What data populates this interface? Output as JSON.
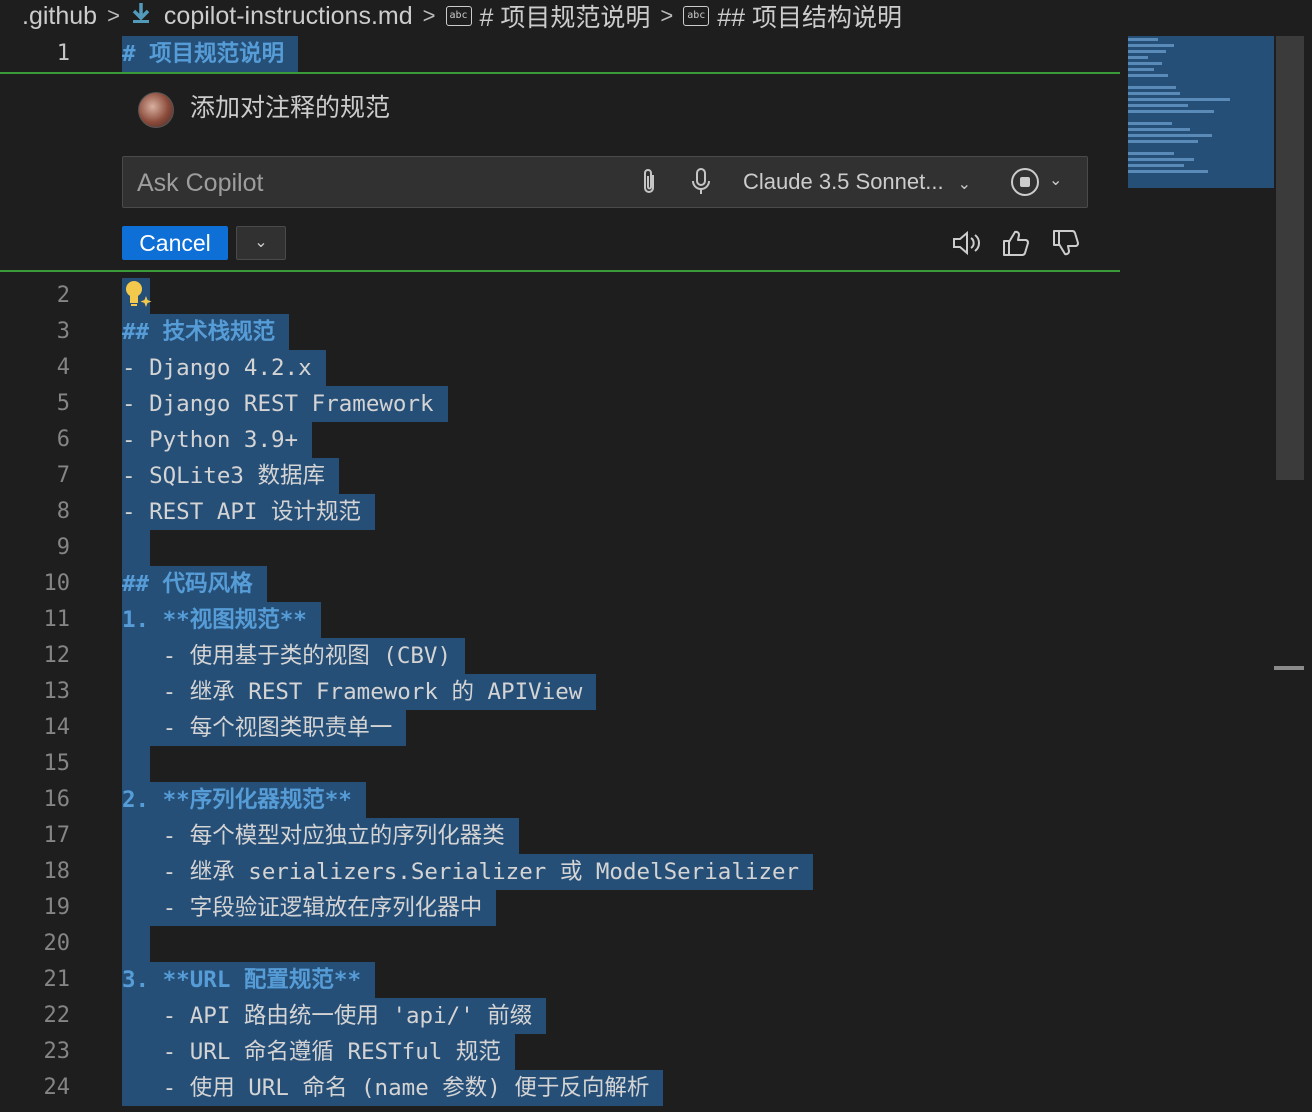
{
  "breadcrumb": {
    "folder": ".github",
    "file": "copilot-instructions.md",
    "symbol1": "# 项目规范说明",
    "symbol2": "## 项目结构说明",
    "symbol_icon_text": "abc",
    "file_icon": "download-arrow-icon"
  },
  "editor": {
    "line1": {
      "number": "1",
      "text": "# 项目规范说明"
    },
    "lines": [
      {
        "number": "2",
        "text": ""
      },
      {
        "number": "3",
        "text": "## 技术栈规范"
      },
      {
        "number": "4",
        "text": "- Django 4.2.x"
      },
      {
        "number": "5",
        "text": "- Django REST Framework"
      },
      {
        "number": "6",
        "text": "- Python 3.9+"
      },
      {
        "number": "7",
        "text": "- SQLite3 数据库"
      },
      {
        "number": "8",
        "text": "- REST API 设计规范"
      },
      {
        "number": "9",
        "text": ""
      },
      {
        "number": "10",
        "text": "## 代码风格"
      },
      {
        "number": "11",
        "text": "1. **视图规范**"
      },
      {
        "number": "12",
        "text": "   - 使用基于类的视图 (CBV)"
      },
      {
        "number": "13",
        "text": "   - 继承 REST Framework 的 APIView"
      },
      {
        "number": "14",
        "text": "   - 每个视图类职责单一"
      },
      {
        "number": "15",
        "text": ""
      },
      {
        "number": "16",
        "text": "2. **序列化器规范**"
      },
      {
        "number": "17",
        "text": "   - 每个模型对应独立的序列化器类"
      },
      {
        "number": "18",
        "text": "   - 继承 serializers.Serializer 或 ModelSerializer"
      },
      {
        "number": "19",
        "text": "   - 字段验证逻辑放在序列化器中"
      },
      {
        "number": "20",
        "text": ""
      },
      {
        "number": "21",
        "text": "3. **URL 配置规范**"
      },
      {
        "number": "22",
        "text": "   - API 路由统一使用 'api/' 前缀"
      },
      {
        "number": "23",
        "text": "   - URL 命名遵循 RESTful 规范"
      },
      {
        "number": "24",
        "text": "   - 使用 URL 命名 (name 参数) 便于反向解析"
      }
    ]
  },
  "chat": {
    "request_text": "添加对注释的规范",
    "input_placeholder": "Ask Copilot",
    "model": "Claude 3.5 Sonnet...",
    "cancel_label": "Cancel"
  },
  "colors": {
    "selection": "#264f78",
    "accent_button": "#0e6fd6",
    "widget_border": "#3a9a3a"
  }
}
